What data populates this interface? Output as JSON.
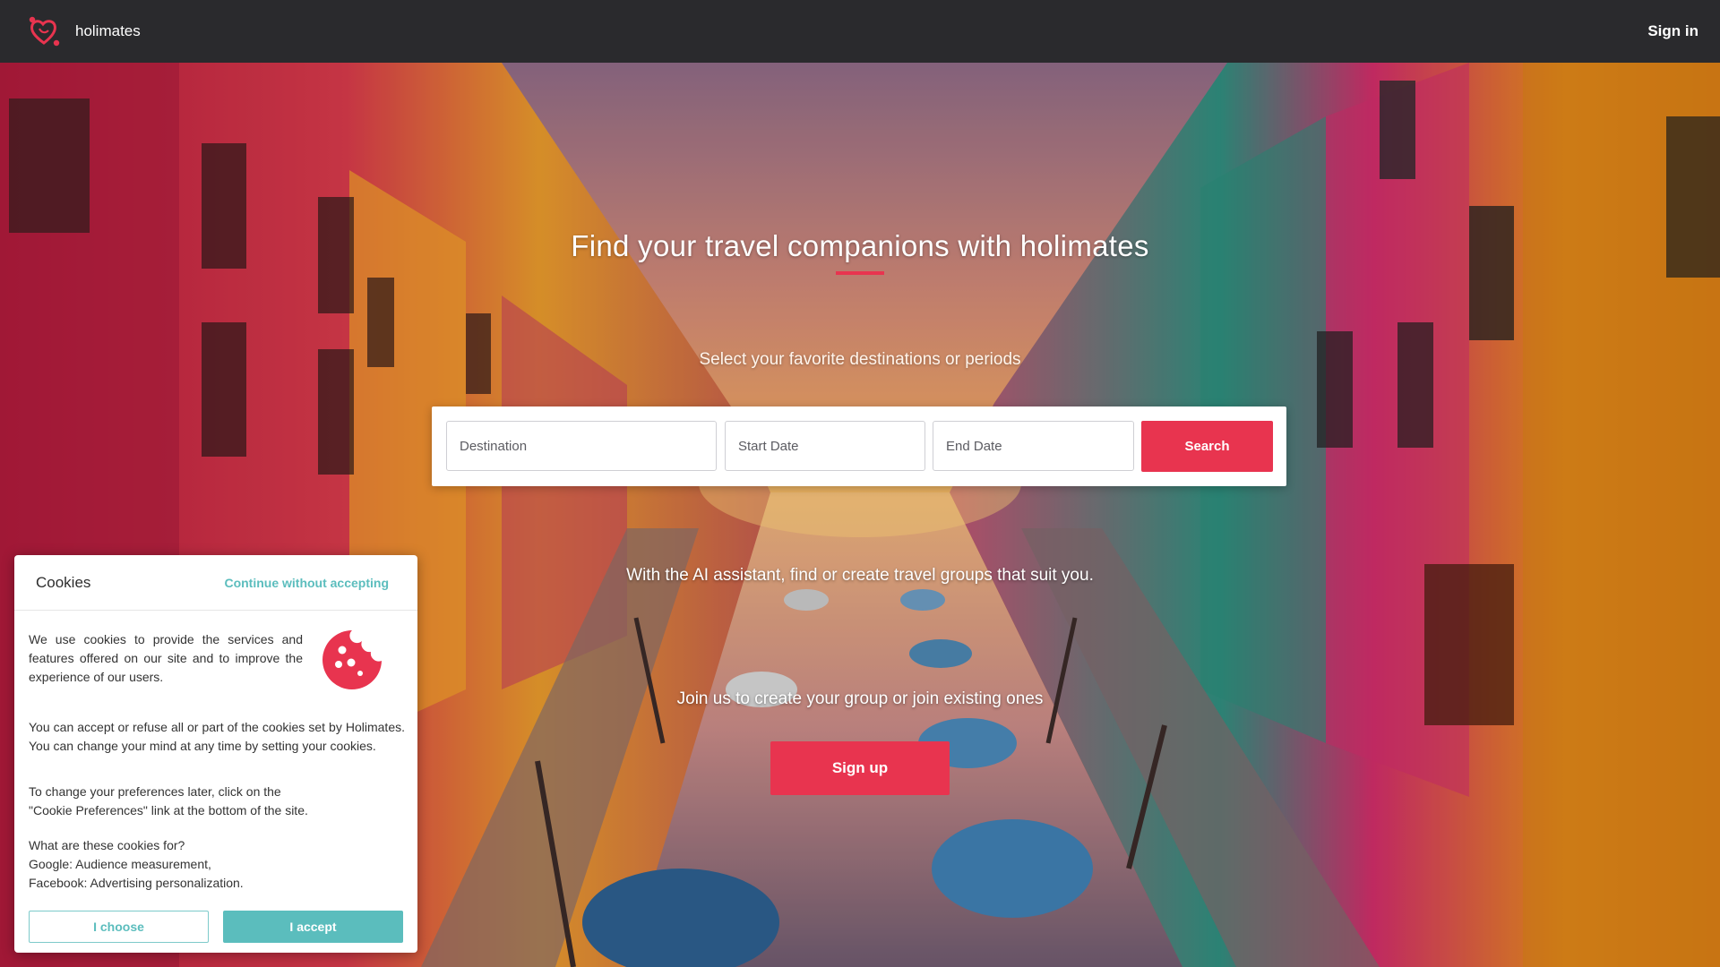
{
  "nav": {
    "brand": "holimates",
    "signin": "Sign in"
  },
  "hero": {
    "title": "Find your travel companions with holimates",
    "subtitle": "Select your favorite destinations or periods",
    "ai_text": "With the AI assistant, find or create travel groups that suit you.",
    "join_text": "Join us to create your group or join existing ones",
    "signup_label": "Sign up"
  },
  "search": {
    "destination_placeholder": "Destination",
    "start_placeholder": "Start Date",
    "end_placeholder": "End Date",
    "button_label": "Search"
  },
  "cookies": {
    "title": "Cookies",
    "continue_label": "Continue without accepting",
    "p1": "We use cookies to provide the services and features offered on our site and to improve the experience of our users.",
    "p2": "You can accept or refuse all or part of the cookies set by Holimates. You can change your mind at any time by setting your cookies.",
    "p3_line1": "To change your preferences later, click on the",
    "p3_line2": "\"Cookie Preferences\" link at the bottom of the site.",
    "p4_line1": "What are these cookies for?",
    "p4_line2": "Google: Audience measurement,",
    "p4_line3": "Facebook: Advertising personalization.",
    "choose_label": "I choose",
    "accept_label": "I accept"
  },
  "colors": {
    "accent": "#e8344f",
    "teal": "#5bbdbd",
    "nav_bg": "#2a2a2d"
  }
}
